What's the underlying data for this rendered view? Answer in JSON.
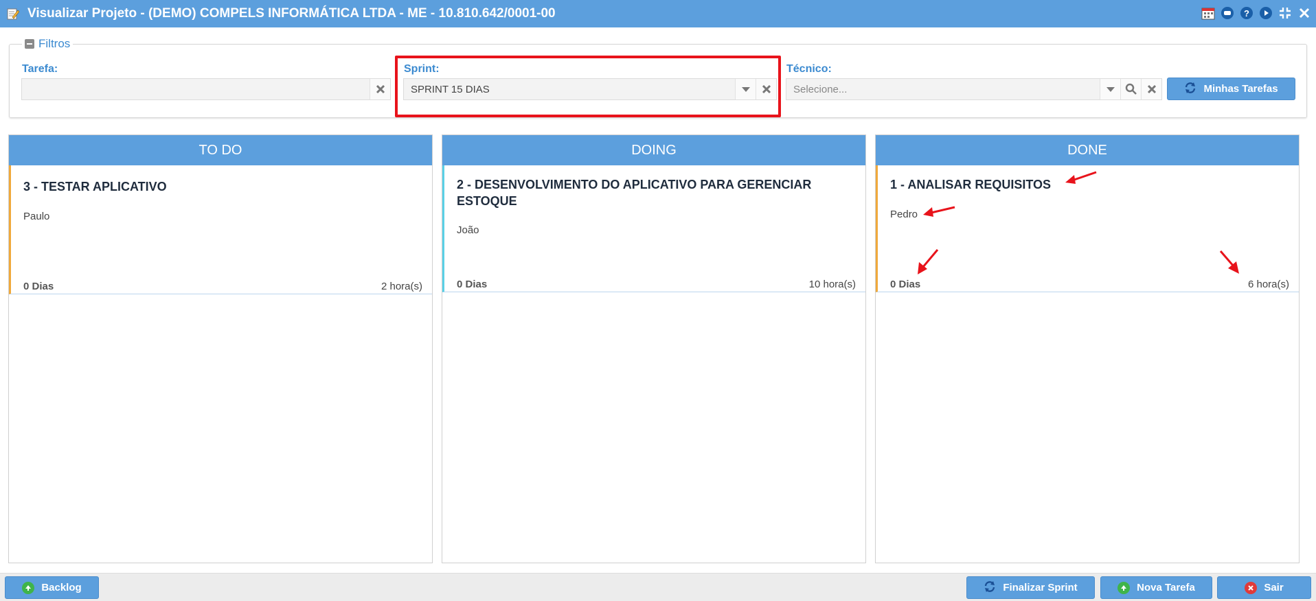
{
  "window": {
    "title": "Visualizar Projeto - (DEMO) COMPELS INFORMÁTICA LTDA - ME - 10.810.642/0001-00",
    "icons": [
      "calendar-icon",
      "chat-icon",
      "help-icon",
      "play-icon",
      "compress-icon",
      "close-icon"
    ]
  },
  "filters": {
    "legend": "Filtros",
    "tarefa": {
      "label": "Tarefa:",
      "value": ""
    },
    "sprint": {
      "label": "Sprint:",
      "value": "SPRINT 15 DIAS"
    },
    "tecnico": {
      "label": "Técnico:",
      "placeholder": "Selecione..."
    },
    "minhas_tarefas_label": "Minhas Tarefas"
  },
  "columns": [
    {
      "title": "TO DO",
      "accent": "#f0a93b",
      "cards": [
        {
          "title": "3 - TESTAR APLICATIVO",
          "person": "Paulo",
          "days": "0 Dias",
          "hours": "2 hora(s)"
        }
      ]
    },
    {
      "title": "DOING",
      "accent": "#5ad0e6",
      "cards": [
        {
          "title": "2 - DESENVOLVIMENTO DO APLICATIVO PARA GERENCIAR ESTOQUE",
          "person": "João",
          "days": "0 Dias",
          "hours": "10 hora(s)"
        }
      ]
    },
    {
      "title": "DONE",
      "accent": "#f0a93b",
      "cards": [
        {
          "title": "1 - ANALISAR REQUISITOS",
          "person": "Pedro",
          "days": "0 Dias",
          "hours": "6 hora(s)"
        }
      ]
    }
  ],
  "footer": {
    "backlog_label": "Backlog",
    "finalizar_label": "Finalizar Sprint",
    "nova_tarefa_label": "Nova Tarefa",
    "sair_label": "Sair"
  },
  "colors": {
    "primary": "#5c9fdd",
    "label_blue": "#3b8ad0",
    "highlight_red": "#e8131b",
    "annotation_arrow": "#e8131b"
  }
}
